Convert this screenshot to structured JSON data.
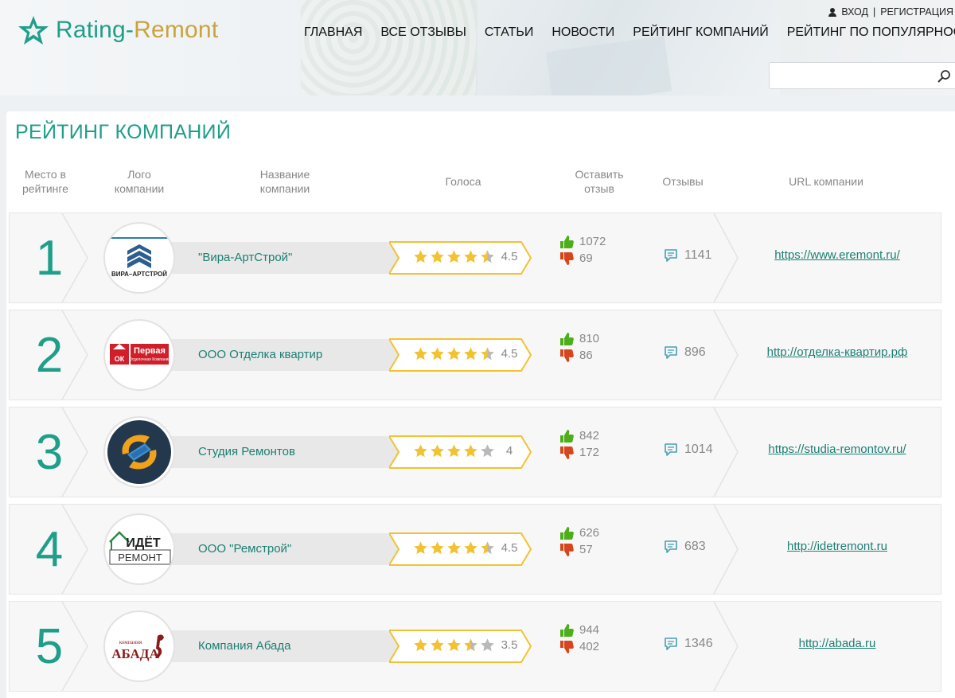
{
  "brand": {
    "part1": "Rating-",
    "part2": "Remont"
  },
  "auth": {
    "login": "ВХОД",
    "separator": "|",
    "register": "РЕГИСТРАЦИЯ"
  },
  "nav": [
    "ГЛАВНАЯ",
    "ВСЕ ОТЗЫВЫ",
    "СТАТЬИ",
    "НОВОСТИ",
    "РЕЙТИНГ КОМПАНИЙ",
    "РЕЙТИНГ ПО ПОПУЛЯРНОСТИ"
  ],
  "search": {
    "value": "",
    "placeholder": ""
  },
  "page_title": "РЕЙТИНГ КОМПАНИЙ",
  "columns": {
    "place": [
      "Место в",
      "рейтинге"
    ],
    "logo": [
      "Лого",
      "компании"
    ],
    "name": [
      "Название",
      "компании"
    ],
    "votes": [
      "Голоса"
    ],
    "leave": [
      "Оставить",
      "отзыв"
    ],
    "reviews": [
      "Отзывы"
    ],
    "url": [
      "URL компании"
    ]
  },
  "colors": {
    "accent": "#1f9e8a",
    "gold": "#c9a43c",
    "star": "#f2c233",
    "like": "#4caf1a",
    "dislike": "#d8451c"
  },
  "companies": [
    {
      "rank": "1",
      "logo_text": "ВИРА–АРТСТРОЙ",
      "name": "\"Вира-АртСтрой\"",
      "rating": 4.5,
      "rating_label": "4.5",
      "likes": "1072",
      "dislikes": "69",
      "reviews": "1141",
      "url": "https://www.eremont.ru/"
    },
    {
      "rank": "2",
      "logo_text": "Первая",
      "logo_sub": "Отделочная Компания",
      "logo_ok": "ОК",
      "name": "ООО Отделка квартир",
      "rating": 4.5,
      "rating_label": "4.5",
      "likes": "810",
      "dislikes": "86",
      "reviews": "896",
      "url": "http://отделка-квартир.рф"
    },
    {
      "rank": "3",
      "name": "Студия Ремонтов",
      "rating": 4,
      "rating_label": "4",
      "likes": "842",
      "dislikes": "172",
      "reviews": "1014",
      "url": "https://studia-remontov.ru/"
    },
    {
      "rank": "4",
      "logo_top": "ИДЁТ",
      "logo_bottom": "РЕМОНТ",
      "name": "ООО \"Ремстрой\"",
      "rating": 4.5,
      "rating_label": "4.5",
      "likes": "626",
      "dislikes": "57",
      "reviews": "683",
      "url": "http://idetremont.ru"
    },
    {
      "rank": "5",
      "logo_top": "компания",
      "logo_bottom": "АБАДА",
      "name": "Компания Абада",
      "rating": 3.5,
      "rating_label": "3.5",
      "likes": "944",
      "dislikes": "402",
      "reviews": "1346",
      "url": "http://abada.ru"
    }
  ]
}
